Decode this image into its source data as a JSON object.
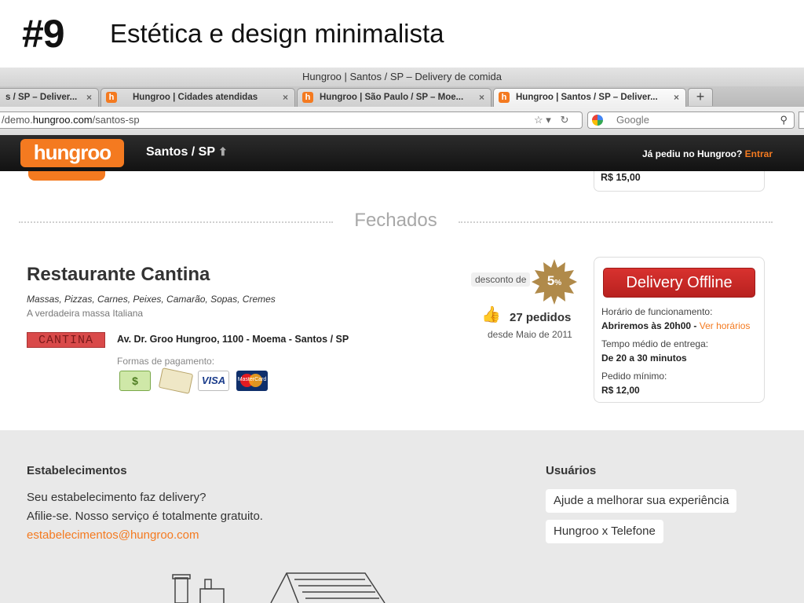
{
  "slide": {
    "number": "#9",
    "title": "Estética e design minimalista"
  },
  "browser": {
    "window_title": "Hungroo | Santos / SP – Delivery de comida",
    "tabs": [
      {
        "label": "s / SP – Deliver...",
        "active": false
      },
      {
        "label": "Hungroo | Cidades atendidas",
        "active": false
      },
      {
        "label": "Hungroo | São Paulo / SP – Moe...",
        "active": false
      },
      {
        "label": "Hungroo | Santos / SP – Deliver...",
        "active": true
      }
    ],
    "tab_close": "×",
    "new_tab": "+",
    "url_prefix": "/demo.",
    "url_domain": "hungroo.com",
    "url_path": "/santos-sp",
    "search_placeholder": "Google"
  },
  "site": {
    "logo": "hungroo",
    "city": "Santos / SP",
    "login_prompt": "Já pediu no Hungroo?",
    "login_link": "Entrar"
  },
  "previous_card": {
    "min_order_value": "R$ 15,00"
  },
  "section_label": "Fechados",
  "restaurant": {
    "name": "Restaurante Cantina",
    "categories": "Massas, Pizzas, Carnes, Peixes, Camarão, Sopas, Cremes",
    "tagline": "A verdadeira massa Italiana",
    "logo_text": "CANTINA",
    "address": "Av. Dr. Groo Hungroo, 1100 - Moema - Santos / SP",
    "payment_label": "Formas de pagamento:",
    "payments": {
      "cash": "$",
      "visa": "VISA",
      "mastercard": "MasterCard"
    },
    "discount_label": "desconto de",
    "discount_value": "5",
    "discount_unit": "%",
    "orders": "27 pedidos",
    "since": "desde Maio de 2011"
  },
  "status": {
    "button": "Delivery Offline",
    "hours_label": "Horário de funcionamento:",
    "hours_value": "Abriremos às 20h00 -",
    "hours_link": "Ver horários",
    "delivery_time_label": "Tempo médio de entrega:",
    "delivery_time_value": "De 20 a 30 minutos",
    "min_order_label": "Pedido mínimo:",
    "min_order_value": "R$ 12,00"
  },
  "footer": {
    "establishments_title": "Estabelecimentos",
    "establishments_line1": "Seu estabelecimento faz delivery?",
    "establishments_line2": "Afilie-se. Nosso serviço é totalmente gratuito.",
    "establishments_email": "estabelecimentos@hungroo.com",
    "users_title": "Usuários",
    "users_link1": "Ajude a melhorar sua experiência",
    "users_link2": "Hungroo x Telefone"
  },
  "colors": {
    "brand_orange": "#f47a20",
    "offline_red": "#c62a27",
    "badge_gold": "#b08a4a"
  }
}
